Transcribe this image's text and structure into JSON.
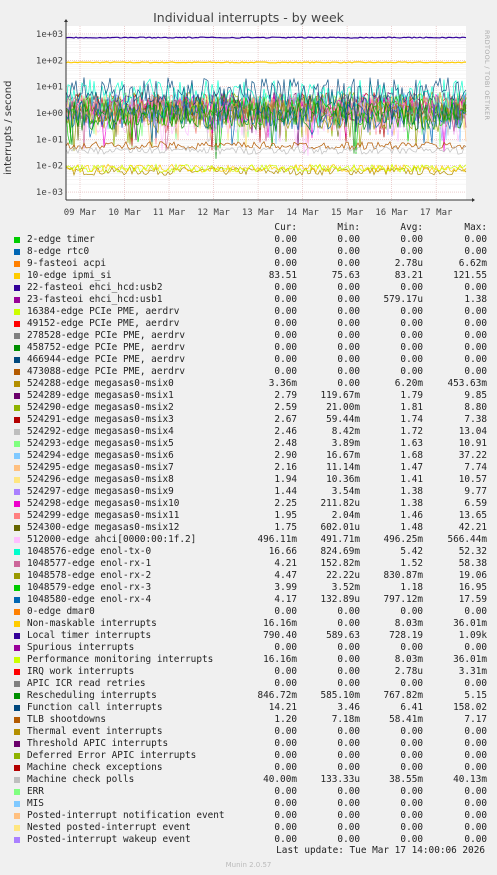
{
  "title": "Individual interrupts - by week",
  "side_label": "RRDTOOL / TOBI OETIKER",
  "update": "Last update: Tue Mar 17 14:00:06 2026",
  "munin": "Munin 2.0.57",
  "headers": {
    "cur": "Cur:",
    "min": "Min:",
    "avg": "Avg:",
    "max": "Max:"
  },
  "chart_data": {
    "type": "line",
    "ylabel": "interrupts / second",
    "yscale": "log",
    "ylim": [
      0.0005,
      2000
    ],
    "yticks": [
      "1e-03",
      "1e-02",
      "1e-01",
      "1e+00",
      "1e+01",
      "1e+02",
      "1e+03"
    ],
    "xticks": [
      "09 Mar",
      "10 Mar",
      "11 Mar",
      "12 Mar",
      "13 Mar",
      "14 Mar",
      "15 Mar",
      "16 Mar",
      "17 Mar"
    ],
    "grid": true,
    "series": [
      {
        "name": "2-edge timer",
        "color": "#00cc00",
        "cur": "0.00",
        "min": "0.00",
        "avg": "0.00",
        "max": "0.00",
        "level": 0
      },
      {
        "name": "8-edge rtc0",
        "color": "#0066b3",
        "cur": "0.00",
        "min": "0.00",
        "avg": "0.00",
        "max": "0.00",
        "level": 0
      },
      {
        "name": "9-fasteoi acpi",
        "color": "#ff8000",
        "cur": "0.00",
        "min": "0.00",
        "avg": "2.78u",
        "max": "6.62m",
        "level": 0
      },
      {
        "name": "10-edge ipmi_si",
        "color": "#ffcc00",
        "cur": "83.51",
        "min": "75.63",
        "avg": "83.21",
        "max": "121.55",
        "level": 83.2
      },
      {
        "name": "22-fasteoi ehci_hcd:usb2",
        "color": "#330099",
        "cur": "0.00",
        "min": "0.00",
        "avg": "0.00",
        "max": "0.00",
        "level": 0
      },
      {
        "name": "23-fasteoi ehci_hcd:usb1",
        "color": "#990099",
        "cur": "0.00",
        "min": "0.00",
        "avg": "579.17u",
        "max": "1.38",
        "level": 0
      },
      {
        "name": "16384-edge PCIe PME, aerdrv",
        "color": "#ccff00",
        "cur": "0.00",
        "min": "0.00",
        "avg": "0.00",
        "max": "0.00",
        "level": 0
      },
      {
        "name": "49152-edge PCIe PME, aerdrv",
        "color": "#ff0000",
        "cur": "0.00",
        "min": "0.00",
        "avg": "0.00",
        "max": "0.00",
        "level": 0
      },
      {
        "name": "278528-edge PCIe PME, aerdrv",
        "color": "#808080",
        "cur": "0.00",
        "min": "0.00",
        "avg": "0.00",
        "max": "0.00",
        "level": 0
      },
      {
        "name": "458752-edge PCIe PME, aerdrv",
        "color": "#008f00",
        "cur": "0.00",
        "min": "0.00",
        "avg": "0.00",
        "max": "0.00",
        "level": 0
      },
      {
        "name": "466944-edge PCIe PME, aerdrv",
        "color": "#00487d",
        "cur": "0.00",
        "min": "0.00",
        "avg": "0.00",
        "max": "0.00",
        "level": 0
      },
      {
        "name": "473088-edge PCIe PME, aerdrv",
        "color": "#b35a00",
        "cur": "0.00",
        "min": "0.00",
        "avg": "0.00",
        "max": "0.00",
        "level": 0
      },
      {
        "name": "524288-edge megasas0-msix0",
        "color": "#b38f00",
        "cur": "3.36m",
        "min": "0.00",
        "avg": "6.20m",
        "max": "453.63m",
        "level": 0.0062
      },
      {
        "name": "524289-edge megasas0-msix1",
        "color": "#6b006b",
        "cur": "2.79",
        "min": "119.67m",
        "avg": "1.79",
        "max": "9.85",
        "level": 1.79
      },
      {
        "name": "524290-edge megasas0-msix2",
        "color": "#8fb300",
        "cur": "2.59",
        "min": "21.00m",
        "avg": "1.81",
        "max": "8.80",
        "level": 1.81
      },
      {
        "name": "524291-edge megasas0-msix3",
        "color": "#b30000",
        "cur": "2.67",
        "min": "59.44m",
        "avg": "1.74",
        "max": "7.38",
        "level": 1.74
      },
      {
        "name": "524292-edge megasas0-msix4",
        "color": "#bebebe",
        "cur": "2.46",
        "min": "8.42m",
        "avg": "1.72",
        "max": "13.04",
        "level": 1.72
      },
      {
        "name": "524293-edge megasas0-msix5",
        "color": "#80ff80",
        "cur": "2.48",
        "min": "3.89m",
        "avg": "1.63",
        "max": "10.91",
        "level": 1.63
      },
      {
        "name": "524294-edge megasas0-msix6",
        "color": "#80c9ff",
        "cur": "2.90",
        "min": "16.67m",
        "avg": "1.68",
        "max": "37.22",
        "level": 1.68
      },
      {
        "name": "524295-edge megasas0-msix7",
        "color": "#ffc080",
        "cur": "2.16",
        "min": "11.14m",
        "avg": "1.47",
        "max": "7.74",
        "level": 1.47
      },
      {
        "name": "524296-edge megasas0-msix8",
        "color": "#ffe680",
        "cur": "1.94",
        "min": "10.36m",
        "avg": "1.41",
        "max": "10.57",
        "level": 1.41
      },
      {
        "name": "524297-edge megasas0-msix9",
        "color": "#aa80ff",
        "cur": "1.44",
        "min": "3.54m",
        "avg": "1.38",
        "max": "9.77",
        "level": 1.38
      },
      {
        "name": "524298-edge megasas0-msix10",
        "color": "#ee00cc",
        "cur": "2.25",
        "min": "211.82u",
        "avg": "1.38",
        "max": "6.59",
        "level": 1.38
      },
      {
        "name": "524299-edge megasas0-msix11",
        "color": "#ff8080",
        "cur": "1.95",
        "min": "2.04m",
        "avg": "1.46",
        "max": "13.65",
        "level": 1.46
      },
      {
        "name": "524300-edge megasas0-msix12",
        "color": "#666600",
        "cur": "1.75",
        "min": "602.01u",
        "avg": "1.48",
        "max": "42.21",
        "level": 1.48
      },
      {
        "name": "512000-edge ahci[0000:00:1f.2]",
        "color": "#ffbfff",
        "cur": "496.11m",
        "min": "491.71m",
        "avg": "496.25m",
        "max": "566.44m",
        "level": 0.496
      },
      {
        "name": "1048576-edge enol-tx-0",
        "color": "#00ffcc",
        "cur": "16.66",
        "min": "824.69m",
        "avg": "5.42",
        "max": "52.32",
        "level": 5.42
      },
      {
        "name": "1048577-edge enol-rx-1",
        "color": "#cc6699",
        "cur": "4.21",
        "min": "152.82m",
        "avg": "1.52",
        "max": "58.38",
        "level": 1.52
      },
      {
        "name": "1048578-edge enol-rx-2",
        "color": "#999900",
        "cur": "4.47",
        "min": "22.22u",
        "avg": "830.87m",
        "max": "19.06",
        "level": 0.83
      },
      {
        "name": "1048579-edge enol-rx-3",
        "color": "#00cc00",
        "cur": "3.99",
        "min": "3.52m",
        "avg": "1.18",
        "max": "16.95",
        "level": 1.18
      },
      {
        "name": "1048580-edge enol-rx-4",
        "color": "#0066b3",
        "cur": "4.17",
        "min": "132.89u",
        "avg": "797.12m",
        "max": "17.59",
        "level": 0.797
      },
      {
        "name": "0-edge dmar0",
        "color": "#ff8000",
        "cur": "0.00",
        "min": "0.00",
        "avg": "0.00",
        "max": "0.00",
        "level": 0
      },
      {
        "name": "Non-maskable interrupts",
        "color": "#ffcc00",
        "cur": "16.16m",
        "min": "0.00",
        "avg": "8.03m",
        "max": "36.01m",
        "level": 0.008
      },
      {
        "name": "Local timer interrupts",
        "color": "#330099",
        "cur": "790.40",
        "min": "589.63",
        "avg": "728.19",
        "max": "1.09k",
        "level": 728
      },
      {
        "name": "Spurious interrupts",
        "color": "#990099",
        "cur": "0.00",
        "min": "0.00",
        "avg": "0.00",
        "max": "0.00",
        "level": 0
      },
      {
        "name": "Performance monitoring interrupts",
        "color": "#ccff00",
        "cur": "16.16m",
        "min": "0.00",
        "avg": "8.03m",
        "max": "36.01m",
        "level": 0.008
      },
      {
        "name": "IRQ work interrupts",
        "color": "#ff0000",
        "cur": "0.00",
        "min": "0.00",
        "avg": "2.78u",
        "max": "3.31m",
        "level": 0
      },
      {
        "name": "APIC ICR read retries",
        "color": "#808080",
        "cur": "0.00",
        "min": "0.00",
        "avg": "0.00",
        "max": "0.00",
        "level": 0
      },
      {
        "name": "Rescheduling interrupts",
        "color": "#008f00",
        "cur": "846.72m",
        "min": "585.10m",
        "avg": "767.82m",
        "max": "5.15",
        "level": 0.768
      },
      {
        "name": "Function call interrupts",
        "color": "#00487d",
        "cur": "14.21",
        "min": "3.46",
        "avg": "6.41",
        "max": "158.02",
        "level": 6.41
      },
      {
        "name": "TLB shootdowns",
        "color": "#b35a00",
        "cur": "1.20",
        "min": "7.18m",
        "avg": "58.41m",
        "max": "7.17",
        "level": 0.058
      },
      {
        "name": "Thermal event interrupts",
        "color": "#b38f00",
        "cur": "0.00",
        "min": "0.00",
        "avg": "0.00",
        "max": "0.00",
        "level": 0
      },
      {
        "name": "Threshold APIC interrupts",
        "color": "#6b006b",
        "cur": "0.00",
        "min": "0.00",
        "avg": "0.00",
        "max": "0.00",
        "level": 0
      },
      {
        "name": "Deferred Error APIC interrupts",
        "color": "#8fb300",
        "cur": "0.00",
        "min": "0.00",
        "avg": "0.00",
        "max": "0.00",
        "level": 0
      },
      {
        "name": "Machine check exceptions",
        "color": "#b30000",
        "cur": "0.00",
        "min": "0.00",
        "avg": "0.00",
        "max": "0.00",
        "level": 0
      },
      {
        "name": "Machine check polls",
        "color": "#bebebe",
        "cur": "40.00m",
        "min": "133.33u",
        "avg": "38.55m",
        "max": "40.13m",
        "level": 0.0386
      },
      {
        "name": "ERR",
        "color": "#80ff80",
        "cur": "0.00",
        "min": "0.00",
        "avg": "0.00",
        "max": "0.00",
        "level": 0
      },
      {
        "name": "MIS",
        "color": "#80c9ff",
        "cur": "0.00",
        "min": "0.00",
        "avg": "0.00",
        "max": "0.00",
        "level": 0
      },
      {
        "name": "Posted-interrupt notification event",
        "color": "#ffc080",
        "cur": "0.00",
        "min": "0.00",
        "avg": "0.00",
        "max": "0.00",
        "level": 0
      },
      {
        "name": "Nested posted-interrupt event",
        "color": "#ffe680",
        "cur": "0.00",
        "min": "0.00",
        "avg": "0.00",
        "max": "0.00",
        "level": 0
      },
      {
        "name": "Posted-interrupt wakeup event",
        "color": "#aa80ff",
        "cur": "0.00",
        "min": "0.00",
        "avg": "0.00",
        "max": "0.00",
        "level": 0
      }
    ]
  }
}
